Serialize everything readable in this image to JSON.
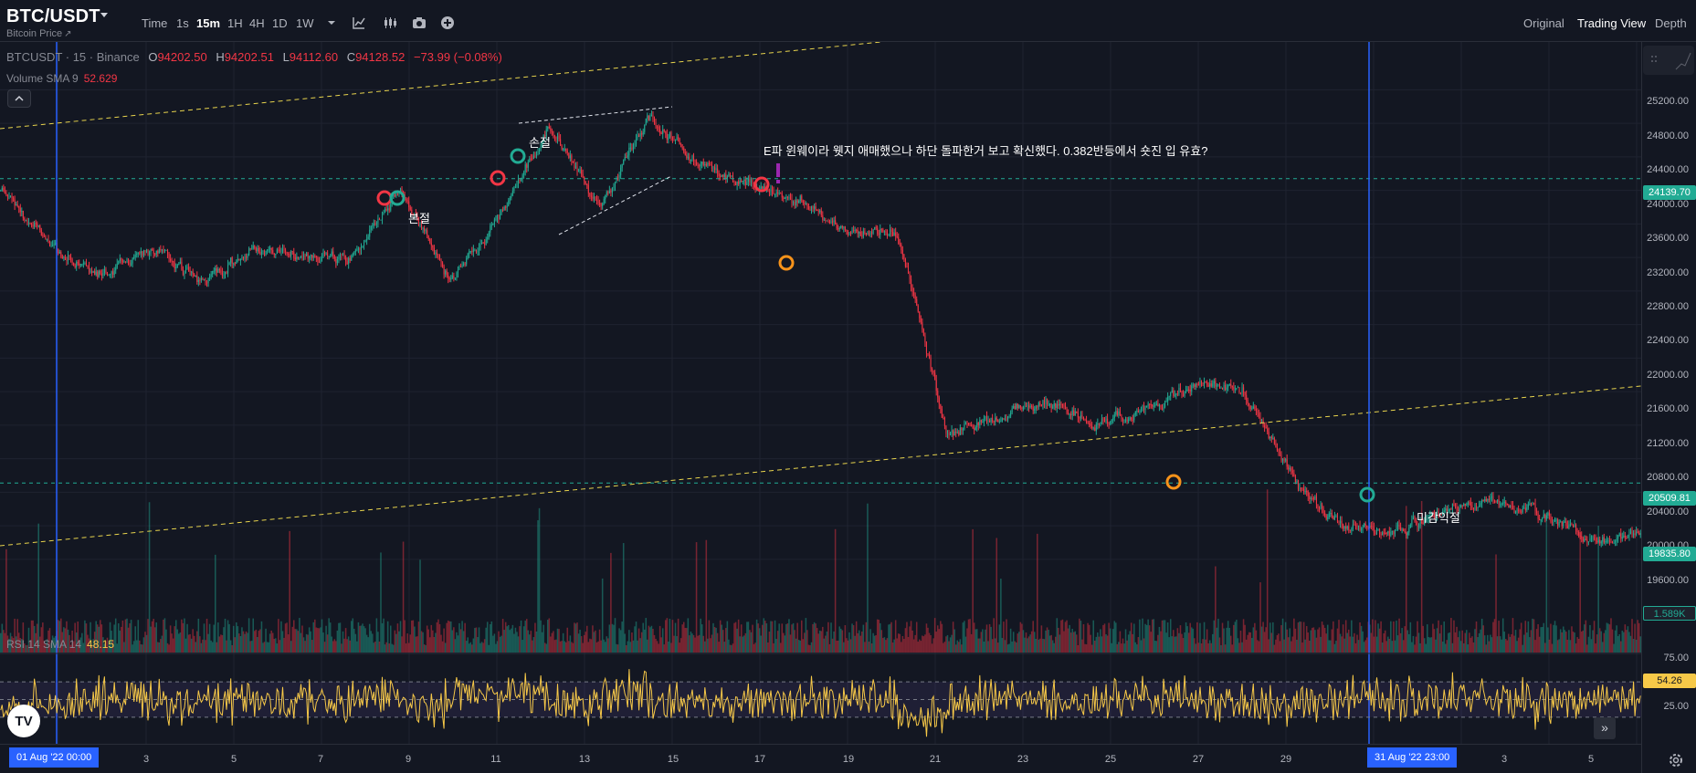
{
  "header": {
    "symbol": "BTC/USDT",
    "subtitle": "Bitcoin Price",
    "timeframes": [
      "Time",
      "1s",
      "15m",
      "1H",
      "4H",
      "1D",
      "1W"
    ],
    "active_timeframe": "15m",
    "views": [
      "Original",
      "Trading View",
      "Depth"
    ],
    "active_view": "Trading View"
  },
  "legend": {
    "ticker": "BTCUSDT · 15 · Binance",
    "open_label": "O",
    "open": "94202.50",
    "high_label": "H",
    "high": "94202.51",
    "low_label": "L",
    "low": "94112.60",
    "close_label": "C",
    "close": "94128.52",
    "change": "−73.99 (−0.08%)",
    "volume_name": "Volume SMA 9",
    "volume_value": "52.629",
    "rsi_name": "RSI 14 SMA 14",
    "rsi_value": "48.15"
  },
  "price_axis": {
    "labels": [
      "25200.00",
      "24800.00",
      "24400.00",
      "24000.00",
      "23600.00",
      "23200.00",
      "22800.00",
      "22400.00",
      "22000.00",
      "21600.00",
      "21200.00",
      "20800.00",
      "20400.00",
      "20000.00",
      "19600.00"
    ],
    "tags": [
      {
        "value": "24139.70",
        "color": "#22ab94"
      },
      {
        "value": "20509.81",
        "color": "#22ab94"
      },
      {
        "value": "19835.80",
        "color": "#22ab94"
      },
      {
        "value": "1.589K",
        "color": "#22ab94"
      },
      {
        "value": "54.26",
        "color": "#f7c948"
      }
    ],
    "rsi_labels": [
      "75.00",
      "25.00"
    ]
  },
  "annotations": {
    "main_note": "E파 윈웨이라 웻지 애매했으나 하단 돌파한거 보고 확신했다. 0.382반등에서 숏진 입 유효?",
    "label_1": "본절",
    "label_2": "손절",
    "label_3": "미감익절"
  },
  "time_axis": {
    "labels": [
      "3",
      "5",
      "7",
      "9",
      "11",
      "13",
      "15",
      "17",
      "19",
      "21",
      "23",
      "25",
      "27",
      "29",
      "3",
      "5"
    ],
    "cursor_left": "01 Aug '22   00:00",
    "cursor_right": "31 Aug '22   23:00"
  },
  "colors": {
    "up": "#22ab94",
    "down": "#f23645",
    "background": "#131722",
    "rsi": "#f7c948",
    "cursor": "#2962ff",
    "trendline": "#e8d44d"
  },
  "chart_data": {
    "type": "candlestick",
    "price_range": [
      19500,
      25400
    ],
    "trend": [
      [
        1,
        24000
      ],
      [
        2,
        23300
      ],
      [
        3,
        23000
      ],
      [
        4,
        23300
      ],
      [
        5,
        22900
      ],
      [
        6,
        23300
      ],
      [
        7,
        23200
      ],
      [
        8,
        23200
      ],
      [
        9,
        24000
      ],
      [
        10,
        22900
      ],
      [
        11,
        23700
      ],
      [
        12,
        24800
      ],
      [
        13,
        23800
      ],
      [
        14,
        24900
      ],
      [
        15,
        24300
      ],
      [
        16,
        24100
      ],
      [
        17,
        23900
      ],
      [
        18,
        23500
      ],
      [
        19,
        23500
      ],
      [
        20,
        21100
      ],
      [
        21,
        21300
      ],
      [
        22,
        21500
      ],
      [
        23,
        21200
      ],
      [
        24,
        21400
      ],
      [
        25,
        21700
      ],
      [
        26,
        21600
      ],
      [
        27,
        20500
      ],
      [
        28,
        20000
      ],
      [
        29,
        19900
      ],
      [
        30,
        20200
      ],
      [
        31,
        20300
      ],
      [
        32,
        20100
      ],
      [
        33,
        19800
      ],
      [
        34,
        19900
      ]
    ],
    "rsi_range": [
      0,
      100
    ],
    "rsi_bands": [
      30,
      70
    ]
  }
}
